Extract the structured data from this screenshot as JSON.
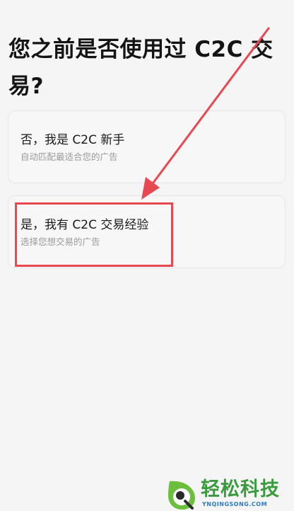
{
  "page": {
    "title": "您之前是否使用过 C2C 交易?"
  },
  "options": [
    {
      "title": "否，我是 C2C 新手",
      "subtitle": "自动匹配最适合您的广告"
    },
    {
      "title": "是，我有 C2C 交易经验",
      "subtitle": "选择您想交易的广告"
    }
  ],
  "annotation": {
    "color": "#e8484f"
  },
  "watermark": {
    "name": "轻松科技",
    "url": "YNQINGSONG.COM",
    "icon": "leaf-logo-icon"
  }
}
